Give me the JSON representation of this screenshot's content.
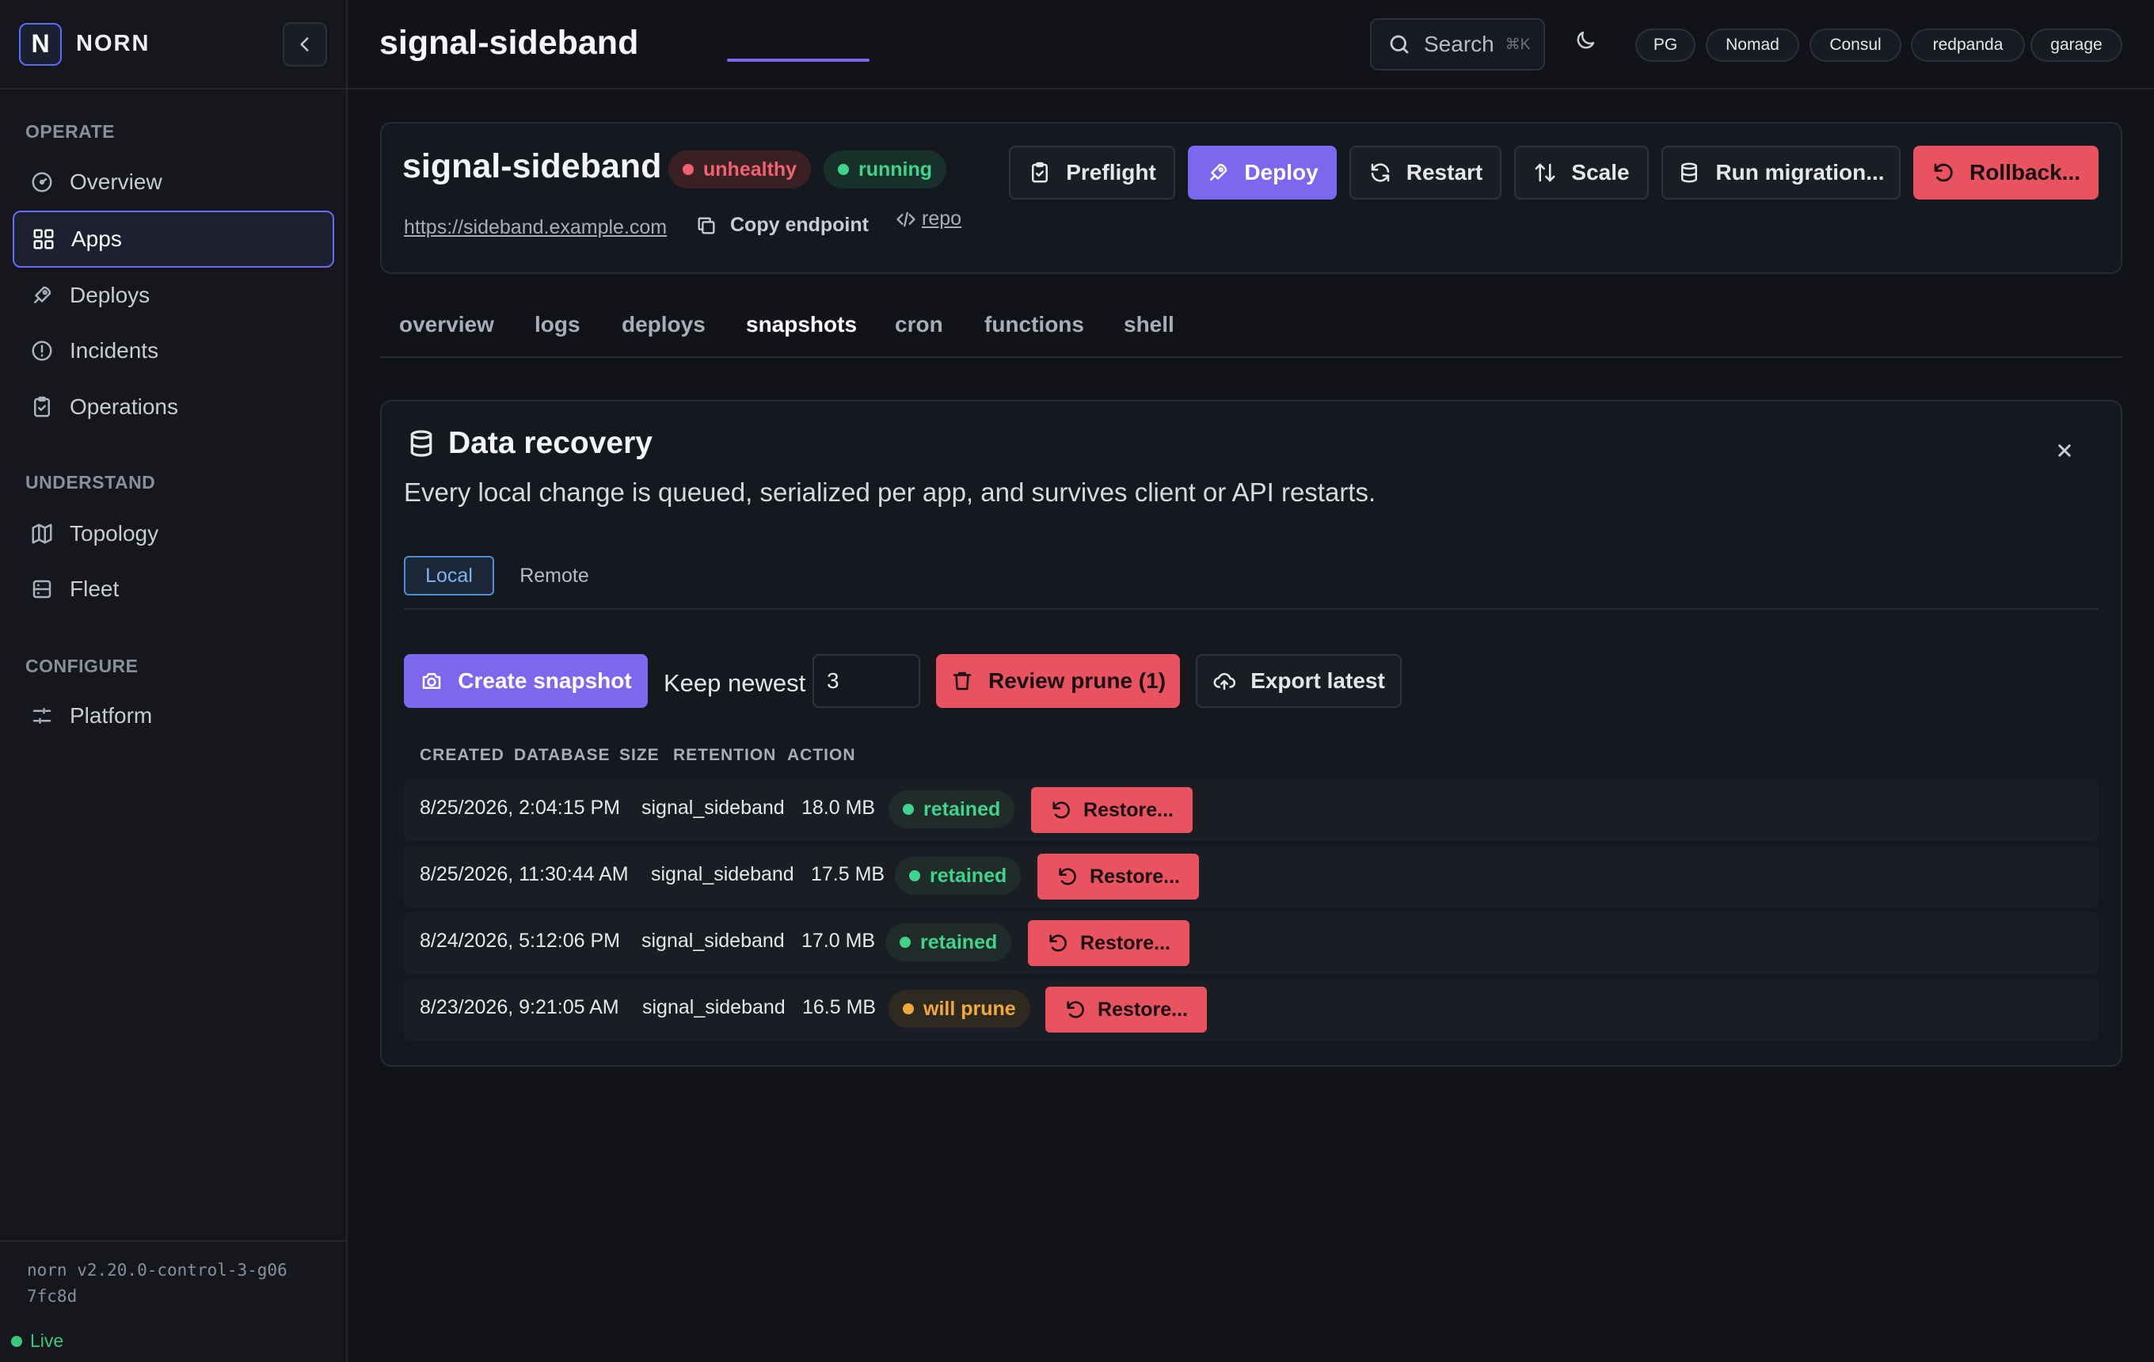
{
  "brand": {
    "logo_letter": "N",
    "name": "NORN"
  },
  "nav": {
    "sections": [
      {
        "title": "OPERATE"
      },
      {
        "title": "UNDERSTAND"
      },
      {
        "title": "CONFIGURE"
      }
    ],
    "items": [
      {
        "label": "Overview",
        "icon": "gauge-icon"
      },
      {
        "label": "Apps",
        "icon": "grid-icon",
        "active": true
      },
      {
        "label": "Deploys",
        "icon": "rocket-icon"
      },
      {
        "label": "Incidents",
        "icon": "alert-circle-icon"
      },
      {
        "label": "Operations",
        "icon": "clipboard-icon"
      },
      {
        "label": "Topology",
        "icon": "map-icon"
      },
      {
        "label": "Fleet",
        "icon": "server-icon"
      },
      {
        "label": "Platform",
        "icon": "sliders-icon"
      }
    ]
  },
  "footer": {
    "version": "norn v2.20.0-control-3-g067fc8d",
    "status": "Live"
  },
  "topbar": {
    "title": "signal-sideband",
    "search_label": "Search",
    "search_shortcut": "⌘K",
    "services": [
      "PG",
      "Nomad",
      "Consul",
      "redpanda",
      "garage"
    ]
  },
  "app": {
    "name": "signal-sideband",
    "health_badge": "unhealthy",
    "state_badge": "running",
    "endpoint": "https://sideband.example.com",
    "copy_label": "Copy endpoint",
    "repo_label": "repo",
    "actions": {
      "preflight": "Preflight",
      "deploy": "Deploy",
      "restart": "Restart",
      "scale": "Scale",
      "migration": "Run migration...",
      "rollback": "Rollback..."
    }
  },
  "tabs": [
    "overview",
    "logs",
    "deploys",
    "snapshots",
    "cron",
    "functions",
    "shell"
  ],
  "active_tab": "snapshots",
  "recovery": {
    "title": "Data recovery",
    "description": "Every local change is queued, serialized per app, and survives client or API restarts.",
    "segments": {
      "local": "Local",
      "remote": "Remote"
    },
    "create_label": "Create snapshot",
    "keep_label": "Keep newest",
    "keep_value": "3",
    "prune_label": "Review prune (1)",
    "export_label": "Export latest",
    "columns": [
      "CREATED",
      "DATABASE",
      "SIZE",
      "RETENTION",
      "ACTION"
    ],
    "rows": [
      {
        "created": "8/25/2026, 2:04:15 PM",
        "database": "signal_sideband",
        "size": "18.0 MB",
        "retention": "retained",
        "action": "Restore..."
      },
      {
        "created": "8/25/2026, 11:30:44 AM",
        "database": "signal_sideband",
        "size": "17.5 MB",
        "retention": "retained",
        "action": "Restore..."
      },
      {
        "created": "8/24/2026, 5:12:06 PM",
        "database": "signal_sideband",
        "size": "17.0 MB",
        "retention": "retained",
        "action": "Restore..."
      },
      {
        "created": "8/23/2026, 9:21:05 AM",
        "database": "signal_sideband",
        "size": "16.5 MB",
        "retention": "will prune",
        "action": "Restore..."
      }
    ]
  },
  "colors": {
    "accent": "#7b68ee",
    "danger": "#e8535f",
    "success": "#3fd48a",
    "warning": "#f2a93b",
    "background": "#111318"
  }
}
